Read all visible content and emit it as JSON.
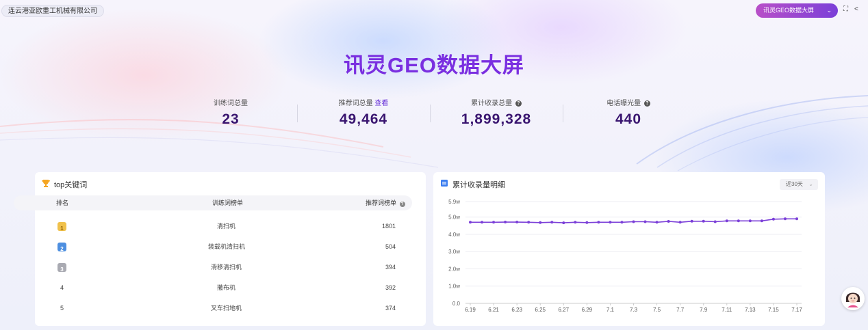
{
  "header": {
    "company": "连云港亚欧重工机械有限公司",
    "screen_select": "讯灵GEO数据大屏",
    "fullscreen_icon": "fullscreen-icon",
    "share_icon": "share-icon"
  },
  "title": "讯灵GEO数据大屏",
  "stats": [
    {
      "label": "训练词总量",
      "value": "23"
    },
    {
      "label": "推荐词总量",
      "link": "查看",
      "value": "49,464"
    },
    {
      "label": "累计收录总量",
      "value": "1,899,328",
      "help_icon": "question-icon"
    },
    {
      "label": "电话曝光量",
      "value": "440",
      "help_icon": "question-icon"
    }
  ],
  "top_keywords": {
    "title": "top关键词",
    "icon": "trophy-icon",
    "columns": [
      "排名",
      "训练词榜单",
      "推荐词榜单"
    ],
    "rows": [
      {
        "rank": "1",
        "keyword": "清扫机",
        "count": "1801",
        "medal": "gold"
      },
      {
        "rank": "2",
        "keyword": "装载机清扫机",
        "count": "504",
        "medal": "blue"
      },
      {
        "rank": "3",
        "keyword": "滑移清扫机",
        "count": "394",
        "medal": "gray"
      },
      {
        "rank": "4",
        "keyword": "撒布机",
        "count": "392"
      },
      {
        "rank": "5",
        "keyword": "叉车扫地机",
        "count": "374"
      }
    ]
  },
  "accumulation": {
    "title": "累计收录量明细",
    "icon": "document-icon",
    "range_label": "近30天"
  },
  "chart_data": {
    "type": "line",
    "title": "累计收录量明细",
    "y_tick_labels": [
      "0.0",
      "1.0w",
      "2.0w",
      "3.0w",
      "4.0w",
      "5.0w",
      "5.9w"
    ],
    "y_ticks": [
      0,
      10000,
      20000,
      30000,
      40000,
      50000,
      59000
    ],
    "ylim": [
      0,
      59000
    ],
    "x_tick_labels": [
      "6.19",
      "6.21",
      "6.23",
      "6.25",
      "6.27",
      "6.29",
      "7.1",
      "7.3",
      "7.5",
      "7.7",
      "7.9",
      "7.11",
      "7.13",
      "7.15",
      "7.17"
    ],
    "x": [
      "6.19",
      "6.20",
      "6.21",
      "6.22",
      "6.23",
      "6.24",
      "6.25",
      "6.26",
      "6.27",
      "6.28",
      "6.29",
      "6.30",
      "7.1",
      "7.2",
      "7.3",
      "7.4",
      "7.5",
      "7.6",
      "7.7",
      "7.8",
      "7.9",
      "7.10",
      "7.11",
      "7.12",
      "7.13",
      "7.14",
      "7.15",
      "7.16",
      "7.17"
    ],
    "series": [
      {
        "values": [
          47000,
          47000,
          47000,
          47100,
          47100,
          47000,
          46800,
          47000,
          46700,
          47000,
          46800,
          47000,
          47000,
          47000,
          47300,
          47300,
          47000,
          47500,
          47000,
          47600,
          47600,
          47300,
          47800,
          47800,
          47800,
          47800,
          48800,
          49000,
          49000
        ],
        "color": "#7b3fd8"
      }
    ],
    "grid": true
  },
  "assistant_icon": "assistant-avatar-icon"
}
